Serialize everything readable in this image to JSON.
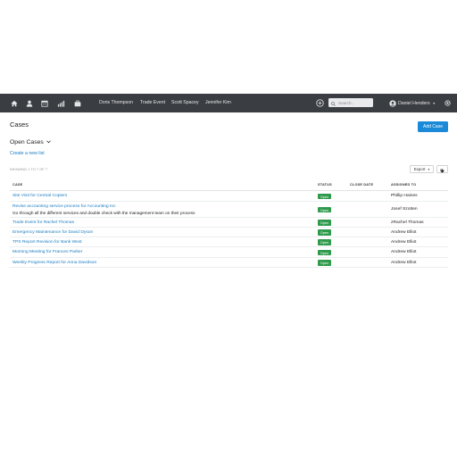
{
  "nav": {
    "icons": [
      "home-icon",
      "person-icon",
      "calendar-icon",
      "bar-chart-icon",
      "briefcase-icon"
    ],
    "links": [
      "Doris Thompson",
      "Trade Event",
      "Scott Spacey",
      "Jennifer Kim"
    ],
    "search_placeholder": "Search...",
    "user_name": "Daniel Henders"
  },
  "page": {
    "title": "Cases",
    "add_button": "Add Case",
    "list_title": "Open Cases",
    "create_list": "Create a new list",
    "showing": "SHOWING 1 TO 7 OF 7",
    "export_label": "Export"
  },
  "table": {
    "columns": [
      "CASE",
      "STATUS",
      "CLOSE DATE",
      "ASSIGNED TO"
    ],
    "rows": [
      {
        "case": "Site Visit for Central Copiers",
        "description": "",
        "status": "Open",
        "close_date": "",
        "assigned": "Phillip Haines"
      },
      {
        "case": "Revise accounting service process for Accounting Inc",
        "description": "Go through all the different services and double check with the management team on their process",
        "status": "Open",
        "close_date": "",
        "assigned": "Josef Szotten"
      },
      {
        "case": "Trade Event for Rachel Thomas",
        "description": "",
        "status": "Open",
        "close_date": "",
        "assigned": "zRachel Thomas"
      },
      {
        "case": "Emergency Maintenance for David Dyson",
        "description": "",
        "status": "Open",
        "close_date": "",
        "assigned": "Andrew Elliot"
      },
      {
        "case": "TPS Report Revision for Bank West",
        "description": "",
        "status": "Open",
        "close_date": "",
        "assigned": "Andrew Elliot"
      },
      {
        "case": "Morning Meeting for Frances Parker",
        "description": "",
        "status": "Open",
        "close_date": "",
        "assigned": "Andrew Elliot"
      },
      {
        "case": "Weekly Progress Report for Anna Davidson",
        "description": "",
        "status": "Open",
        "close_date": "",
        "assigned": "Andrew Elliot"
      }
    ]
  },
  "colors": {
    "topbar": "#3a3d42",
    "accent": "#1a8ad8",
    "link": "#1a7cc1",
    "status_open": "#2f9a4c"
  }
}
